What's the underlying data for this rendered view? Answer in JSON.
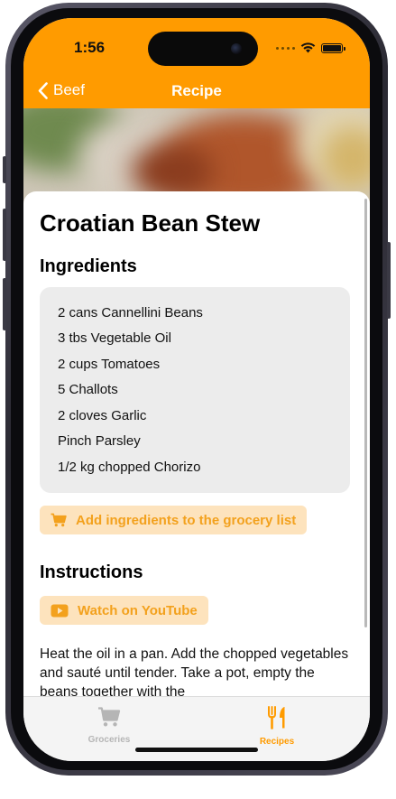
{
  "status_bar": {
    "time": "1:56"
  },
  "nav": {
    "back_label": "Beef",
    "title": "Recipe"
  },
  "recipe": {
    "title": "Croatian Bean Stew",
    "ingredients_heading": "Ingredients",
    "ingredients": [
      "2 cans Cannellini Beans",
      "3 tbs Vegetable Oil",
      "2 cups  Tomatoes",
      "5 Challots",
      "2 cloves Garlic",
      "Pinch Parsley",
      "1/2 kg chopped  Chorizo"
    ],
    "add_to_grocery_label": "Add ingredients to the grocery list",
    "instructions_heading": "Instructions",
    "youtube_label": "Watch on YouTube",
    "instructions_text": "Heat the oil in a pan. Add the chopped vegetables and sauté until tender. Take a pot, empty the beans together with the"
  },
  "tab_bar": {
    "tabs": [
      {
        "label": "Groceries",
        "icon": "cart-icon",
        "selected": false
      },
      {
        "label": "Recipes",
        "icon": "fork-knife-icon",
        "selected": true
      }
    ]
  },
  "colors": {
    "accent": "#ff9b00",
    "pill_background": "#fde3bd",
    "pill_text": "#f3a11d",
    "tab_inactive": "#b5b5b5"
  },
  "icons": {
    "back": "chevron-left-icon",
    "grocery_button": "cart-icon",
    "youtube_button": "play-icon"
  }
}
